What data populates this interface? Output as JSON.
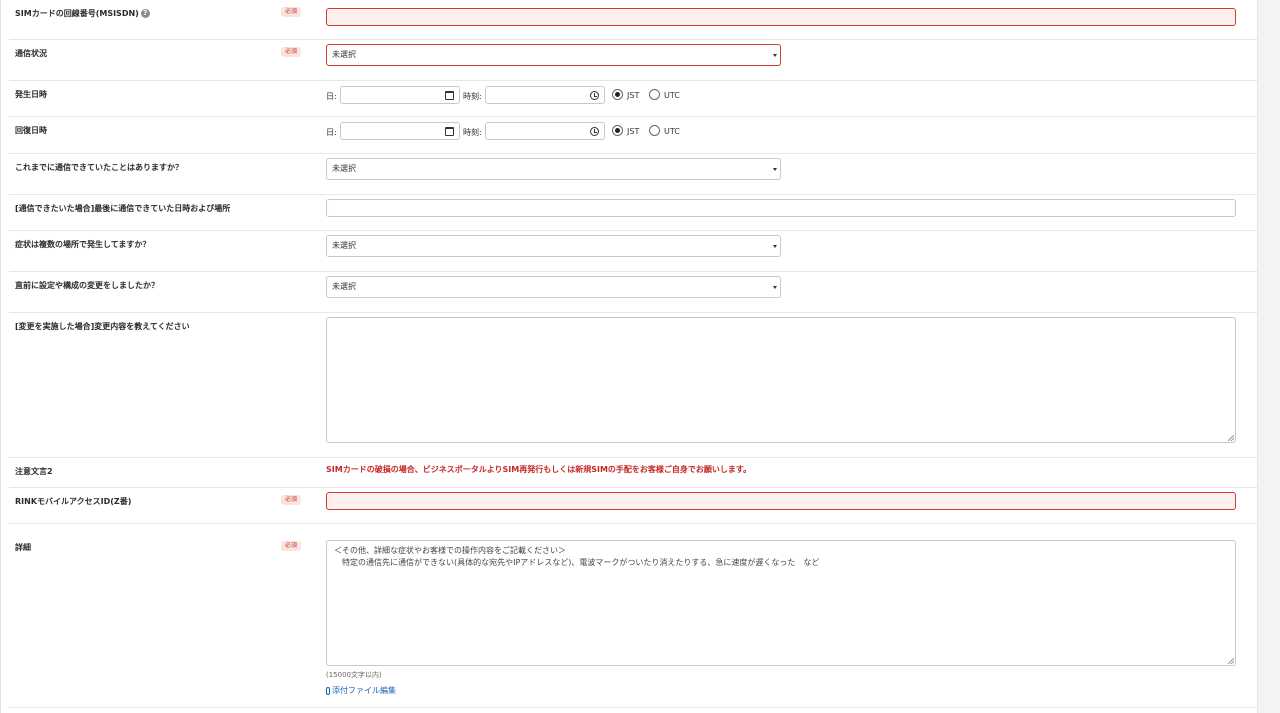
{
  "required_label": "必須",
  "fields": {
    "msisdn": {
      "label": "SIMカードの回線番号(MSISDN)",
      "help": "?",
      "value": ""
    },
    "comm_status": {
      "label": "通信状況",
      "selected": "未選択"
    },
    "occurred": {
      "label": "発生日時",
      "date_label": "日:",
      "time_label": "時刻:",
      "date_value": "",
      "time_value": "",
      "tz_options": [
        "JST",
        "UTC"
      ],
      "tz_selected": "JST"
    },
    "recovered": {
      "label": "回復日時",
      "date_label": "日:",
      "time_label": "時刻:",
      "date_value": "",
      "time_value": "",
      "tz_options": [
        "JST",
        "UTC"
      ],
      "tz_selected": "JST"
    },
    "was_connected": {
      "label": "これまでに通信できていたことはありますか？",
      "selected": "未選択"
    },
    "last_connected": {
      "label": "[通信できたいた場合]最後に通信できていた日時および場所",
      "value": ""
    },
    "multi_location": {
      "label": "症状は複数の場所で発生してますか？",
      "selected": "未選択"
    },
    "changed_config": {
      "label": "直前に設定や構成の変更をしましたか？",
      "selected": "未選択"
    },
    "change_details": {
      "label": "[変更を実施した場合]変更内容を教えてください",
      "value": ""
    },
    "notice2": {
      "label": "注意文言2",
      "text": "SIMカードの破損の場合、ビジネスポータルよりSIM再発行もしくは新規SIMの手配をお客様ご自身でお願いします。"
    },
    "rink_id": {
      "label": "RINKモバイルアクセスID(Z番)",
      "value": ""
    },
    "details": {
      "label": "詳細",
      "line1": "＜その他、詳細な症状やお客様での操作内容をご記載ください＞",
      "line2": "　特定の通信先に通信ができない(具体的な宛先やIPアドレスなど)、電波マークがついたり消えたりする、急に速度が遅くなった　など",
      "limit": "(15000文字以内)",
      "attach": "添付ファイル編集"
    }
  },
  "colors": {
    "error_border": "#d33b2e",
    "notice_red": "#c62828",
    "link_blue": "#1f5fb5"
  }
}
